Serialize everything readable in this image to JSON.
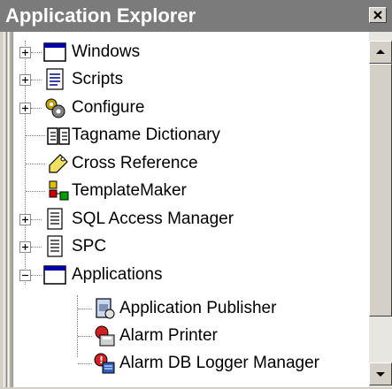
{
  "window": {
    "title": "Application Explorer"
  },
  "tree": {
    "items": [
      {
        "label": "Windows",
        "expander": "plus",
        "icon": "window-icon"
      },
      {
        "label": "Scripts",
        "expander": "plus",
        "icon": "script-icon"
      },
      {
        "label": "Configure",
        "expander": "plus",
        "icon": "gears-icon"
      },
      {
        "label": "Tagname Dictionary",
        "expander": "none",
        "icon": "dictionary-icon"
      },
      {
        "label": "Cross Reference",
        "expander": "none",
        "icon": "tag-icon"
      },
      {
        "label": "TemplateMaker",
        "expander": "none",
        "icon": "template-icon"
      },
      {
        "label": "SQL Access Manager",
        "expander": "plus",
        "icon": "document-icon"
      },
      {
        "label": "SPC",
        "expander": "plus",
        "icon": "document-icon"
      },
      {
        "label": "Applications",
        "expander": "minus",
        "icon": "window-icon"
      },
      {
        "label": "Application Publisher",
        "expander": "none",
        "icon": "publisher-icon"
      },
      {
        "label": "Alarm Printer",
        "expander": "none",
        "icon": "alarm-printer-icon"
      },
      {
        "label": "Alarm DB Logger Manager",
        "expander": "none",
        "icon": "alarm-db-icon"
      }
    ]
  }
}
